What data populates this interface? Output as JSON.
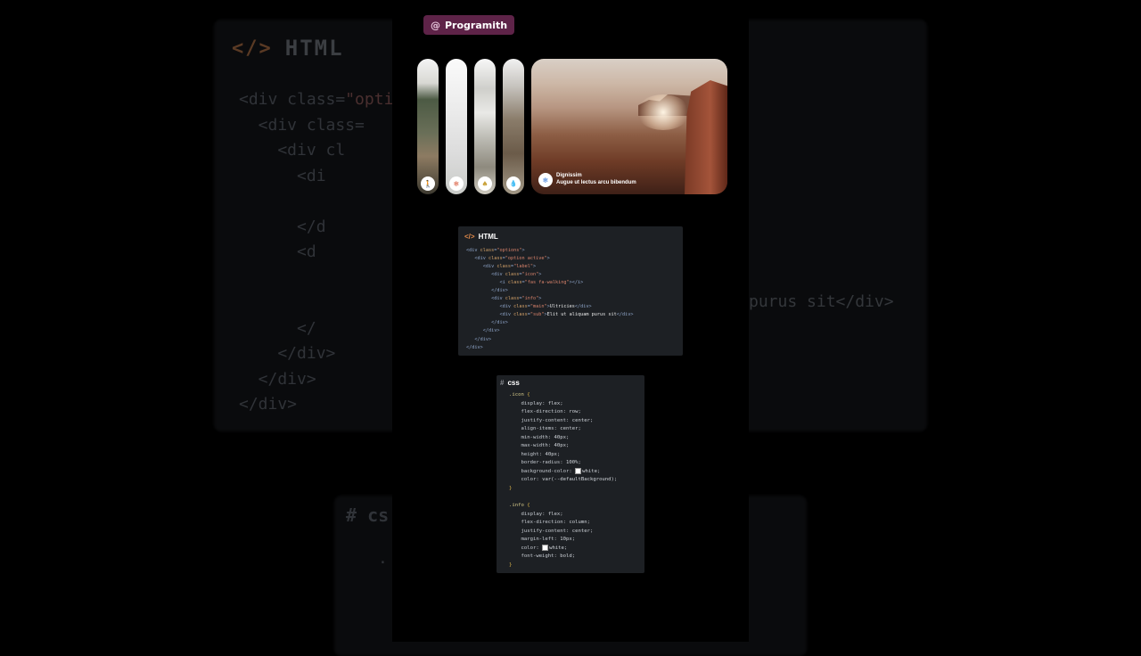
{
  "brand": {
    "label": "Programith"
  },
  "background": {
    "html_title": "HTML",
    "html_code_lines": [
      "<div class=\"opti",
      "  <div class=",
      "    <div cl",
      "      <di",
      "",
      "      </d",
      "      <d",
      "",
      "",
      "      </",
      "    </div>",
      "  </div>",
      "</div>"
    ],
    "right_fragment": "purus sit</div>",
    "css_title": "# cs",
    "css_dot": "."
  },
  "options": {
    "items": [
      {
        "icon": "walking-icon",
        "glyph": "🚶"
      },
      {
        "icon": "snowflake-icon",
        "glyph": "❄"
      },
      {
        "icon": "tree-icon",
        "glyph": "♠"
      },
      {
        "icon": "tint-icon",
        "glyph": "💧"
      }
    ],
    "active": {
      "icon": "snowflake-icon",
      "glyph": "❄",
      "main": "Dignissim",
      "sub": "Augue ut lectus arcu bibendum"
    }
  },
  "html_panel": {
    "title": "HTML",
    "lines": [
      {
        "indent": 0,
        "open": "div",
        "attr": "options"
      },
      {
        "indent": 1,
        "open": "div",
        "attr": "option active"
      },
      {
        "indent": 2,
        "open": "div",
        "attr": "label"
      },
      {
        "indent": 3,
        "open": "div",
        "attr": "icon"
      },
      {
        "indent": 4,
        "open": "i",
        "attr": "fas fa-walking",
        "close": "i"
      },
      {
        "indent": 3,
        "close_only": "div"
      },
      {
        "indent": 3,
        "open": "div",
        "attr": "info"
      },
      {
        "indent": 4,
        "open": "div",
        "attr": "main",
        "text": "Ultricies",
        "close": "div"
      },
      {
        "indent": 4,
        "open": "div",
        "attr": "sub",
        "text": "Elit ut aliquam purus sit",
        "close": "div"
      },
      {
        "indent": 3,
        "close_only": "div"
      },
      {
        "indent": 2,
        "close_only": "div"
      },
      {
        "indent": 1,
        "close_only": "div"
      },
      {
        "indent": 0,
        "close_only": "div"
      }
    ]
  },
  "css_panel": {
    "title": "css",
    "rules": [
      {
        "selector": ".icon",
        "decls": [
          [
            "display",
            "flex"
          ],
          [
            "flex-direction",
            "row"
          ],
          [
            "justify-content",
            "center"
          ],
          [
            "align-items",
            "center"
          ],
          [
            "min-width",
            "40px"
          ],
          [
            "max-width",
            "40px"
          ],
          [
            "height",
            "40px"
          ],
          [
            "border-radius",
            "100%"
          ],
          [
            "background-color",
            "white",
            "swatch"
          ],
          [
            "color",
            "var(--defaultBackground)"
          ]
        ]
      },
      {
        "selector": ".info",
        "decls": [
          [
            "display",
            "flex"
          ],
          [
            "flex-direction",
            "column"
          ],
          [
            "justify-content",
            "center"
          ],
          [
            "margin-left",
            "10px"
          ],
          [
            "color",
            "white",
            "swatch"
          ],
          [
            "font-weight",
            "bold"
          ]
        ]
      }
    ]
  }
}
